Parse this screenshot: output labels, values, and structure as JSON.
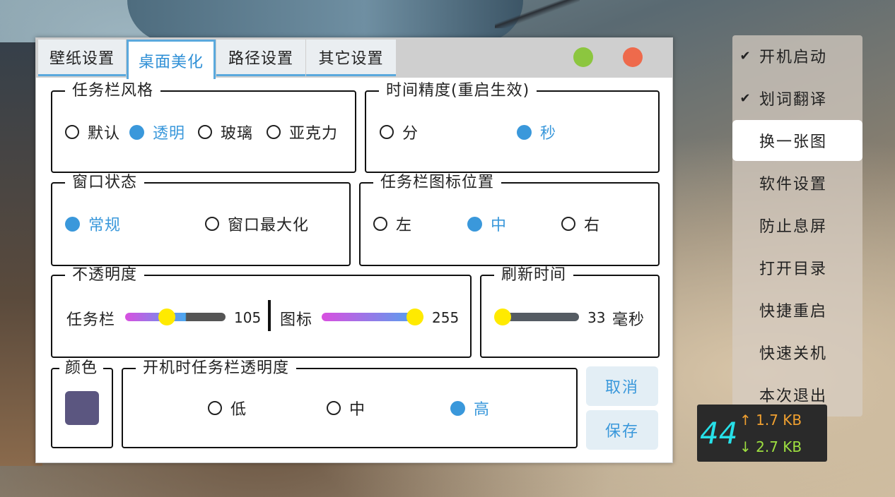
{
  "tabs": [
    "壁纸设置",
    "桌面美化",
    "路径设置",
    "其它设置"
  ],
  "active_tab": "桌面美化",
  "window_buttons": {
    "minimize_color": "#8cc63f",
    "close_color": "#ee6a4c"
  },
  "taskbar_style": {
    "title": "任务栏风格",
    "options": [
      "默认",
      "透明",
      "玻璃",
      "亚克力"
    ],
    "selected": "透明"
  },
  "time_precision": {
    "title": "时间精度(重启生效)",
    "options": [
      "分",
      "秒"
    ],
    "selected": "秒"
  },
  "window_state": {
    "title": "窗口状态",
    "options": [
      "常规",
      "窗口最大化"
    ],
    "selected": "常规"
  },
  "icon_position": {
    "title": "任务栏图标位置",
    "options": [
      "左",
      "中",
      "右"
    ],
    "selected": "中"
  },
  "opacity": {
    "title": "不透明度",
    "taskbar_label": "任务栏",
    "taskbar_value": "105",
    "icon_label": "图标",
    "icon_value": "255",
    "taskbar_fraction": 0.41,
    "icon_fraction": 1.0
  },
  "refresh": {
    "title": "刷新时间",
    "value": "33",
    "unit": "毫秒",
    "fraction": 0.0
  },
  "color": {
    "title": "颜色",
    "swatch": "#5b5680"
  },
  "boot_opacity": {
    "title": "开机时任务栏透明度",
    "options": [
      "低",
      "中",
      "高"
    ],
    "selected": "高"
  },
  "buttons": {
    "cancel": "取消",
    "save": "保存"
  },
  "menu": {
    "items": [
      {
        "label": "开机启动",
        "checked": "✔"
      },
      {
        "label": "划词翻译",
        "checked": "✔"
      },
      {
        "label": "换一张图",
        "checked": ""
      },
      {
        "label": "软件设置",
        "checked": ""
      },
      {
        "label": "防止息屏",
        "checked": ""
      },
      {
        "label": "打开目录",
        "checked": ""
      },
      {
        "label": "快捷重启",
        "checked": ""
      },
      {
        "label": "快速关机",
        "checked": ""
      },
      {
        "label": "本次退出",
        "checked": ""
      }
    ],
    "highlighted": "换一张图"
  },
  "network": {
    "fps": "44",
    "up": "↑ 1.7 KB",
    "down": "↓ 2.7 KB"
  }
}
